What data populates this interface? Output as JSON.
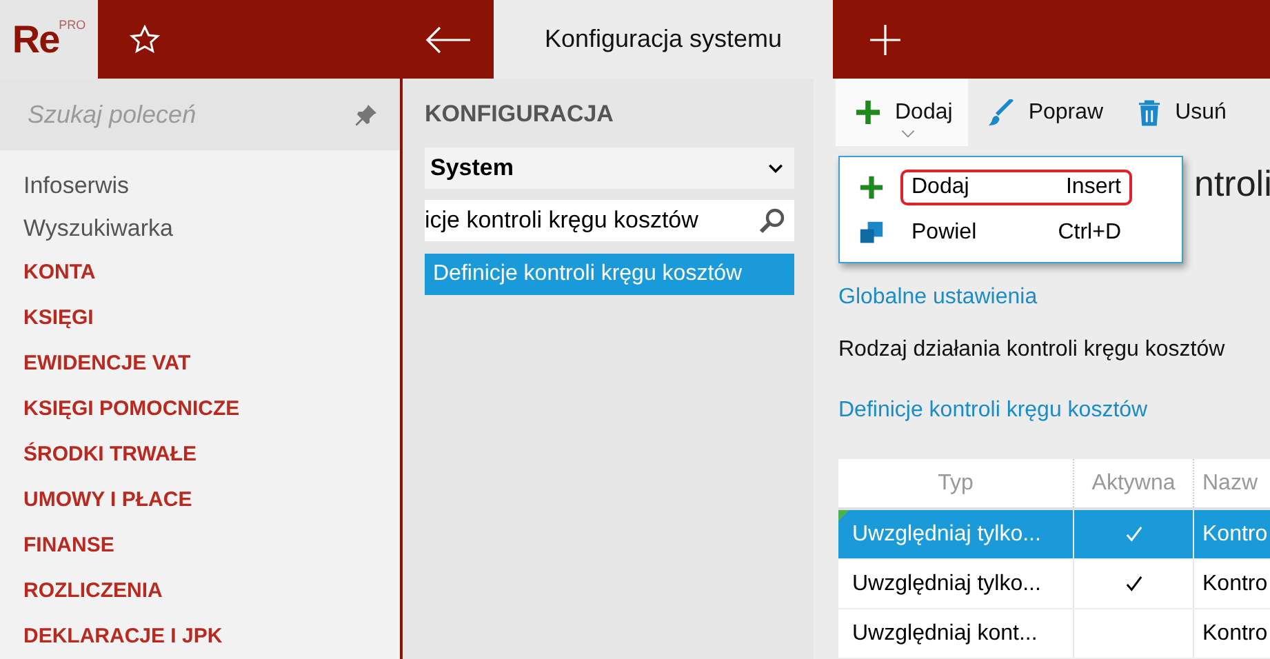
{
  "app": {
    "logo": "Re",
    "logo_badge": "PRO"
  },
  "tab": {
    "title": "Konfiguracja systemu"
  },
  "sidebar": {
    "search_placeholder": "Szukaj poleceń",
    "items": [
      {
        "label": "Infoserwis",
        "kind": "link"
      },
      {
        "label": "Wyszukiwarka",
        "kind": "link"
      },
      {
        "label": "KONTA",
        "kind": "module"
      },
      {
        "label": "KSIĘGI",
        "kind": "module"
      },
      {
        "label": "EWIDENCJE VAT",
        "kind": "module"
      },
      {
        "label": "KSIĘGI POMOCNICZE",
        "kind": "module"
      },
      {
        "label": "ŚRODKI TRWAŁE",
        "kind": "module"
      },
      {
        "label": "UMOWY I PŁACE",
        "kind": "module"
      },
      {
        "label": "FINANSE",
        "kind": "module"
      },
      {
        "label": "ROZLICZENIA",
        "kind": "module"
      },
      {
        "label": "DEKLARACJE I JPK",
        "kind": "module"
      }
    ]
  },
  "config": {
    "title": "KONFIGURACJA",
    "select": "System",
    "search_value": "icje kontroli kręgu kosztów",
    "items": [
      {
        "label": "Definicje kontroli kręgu kosztów",
        "selected": true
      }
    ]
  },
  "toolbar": [
    {
      "label": "Dodaj",
      "kind": "add",
      "selected": true
    },
    {
      "label": "Popraw",
      "kind": "edit",
      "selected": false
    },
    {
      "label": "Usuń",
      "kind": "delete",
      "selected": false
    }
  ],
  "menu": [
    {
      "label": "Dodaj",
      "shortcut": "Insert",
      "kind": "add",
      "selected": true
    },
    {
      "label": "Powiel",
      "shortcut": "Ctrl+D",
      "kind": "copy",
      "selected": false
    }
  ],
  "content": {
    "heading_fragment": "ntroli",
    "section1": "Globalne ustawienia",
    "setting_label": "Rodzaj działania kontroli kręgu kosztów",
    "section2": "Definicje kontroli kręgu kosztów",
    "table": {
      "columns": [
        "Typ",
        "Aktywna",
        "Nazw"
      ],
      "rows": [
        {
          "type": "Uwzględniaj tylko...",
          "active": true,
          "name": "Kontro",
          "selected": true
        },
        {
          "type": "Uwzględniaj tylko...",
          "active": true,
          "name": "Kontro",
          "selected": false
        },
        {
          "type": "Uwzględniaj kont...",
          "active": false,
          "name": "Kontro",
          "selected": false
        }
      ]
    }
  }
}
